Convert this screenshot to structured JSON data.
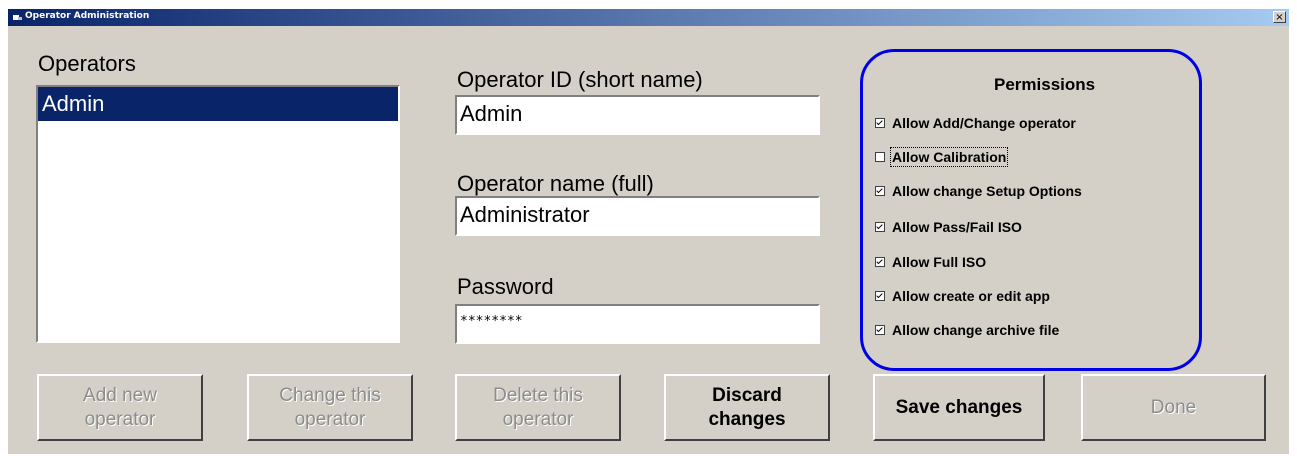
{
  "window": {
    "title": "Operator Administration",
    "close_symbol": "×"
  },
  "operators": {
    "label": "Operators",
    "items": [
      "Admin"
    ]
  },
  "fields": {
    "operator_id": {
      "label": "Operator ID (short name)",
      "value": "Admin"
    },
    "operator_name": {
      "label": "Operator name (full)",
      "value": "Administrator"
    },
    "password": {
      "label": "Password",
      "value": "********"
    }
  },
  "permissions": {
    "title": "Permissions",
    "items": [
      {
        "label": "Allow Add/Change operator",
        "checked": true
      },
      {
        "label": "Allow Calibration",
        "checked": false
      },
      {
        "label": "Allow change Setup Options",
        "checked": true
      },
      {
        "label": "Allow Pass/Fail ISO",
        "checked": true
      },
      {
        "label": "Allow Full ISO",
        "checked": true
      },
      {
        "label": "Allow create or edit app",
        "checked": true
      },
      {
        "label": "Allow change archive file",
        "checked": true
      }
    ]
  },
  "buttons": {
    "add_new": {
      "line1": "Add new",
      "line2": "operator"
    },
    "change_this": {
      "line1": "Change this",
      "line2": "operator"
    },
    "delete_this": {
      "line1": "Delete this",
      "line2": "operator"
    },
    "discard": {
      "line1": "Discard",
      "line2": "changes"
    },
    "save": {
      "label": "Save changes"
    },
    "done": {
      "label": "Done"
    }
  },
  "colors": {
    "highlight": "#0a246a",
    "permissions_border": "#0000e6",
    "face": "#d4d0c8"
  }
}
